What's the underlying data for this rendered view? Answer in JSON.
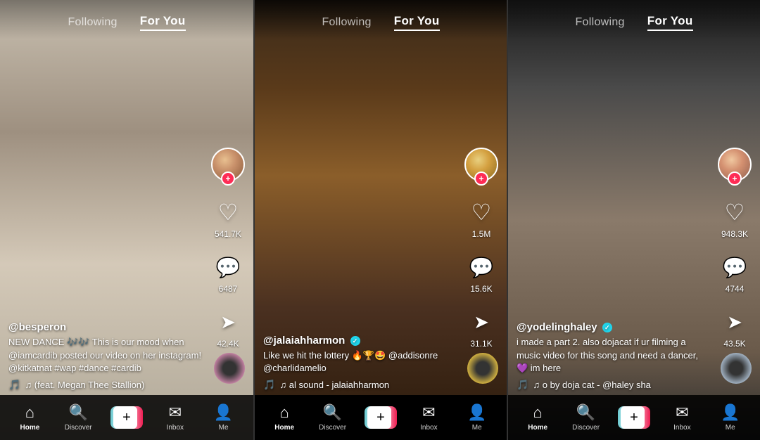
{
  "panels": [
    {
      "id": "panel-1",
      "nav": {
        "following_label": "Following",
        "foryou_label": "For You",
        "active": "foryou"
      },
      "user": {
        "username": "@besperon",
        "verified": false,
        "description": "NEW DANCE 🎶🎶 This is our mood when @iamcardib posted our video on her instagram! @kitkatnat #wap #dance #cardib",
        "music": "♫ (feat. Megan Thee Stallion)"
      },
      "stats": {
        "likes": "541.7K",
        "comments": "6487",
        "shares": "42.4K"
      },
      "bottomnav": {
        "home": "Home",
        "discover": "Discover",
        "inbox": "Inbox",
        "me": "Me"
      }
    },
    {
      "id": "panel-2",
      "nav": {
        "following_label": "Following",
        "foryou_label": "For You",
        "active": "foryou"
      },
      "user": {
        "username": "@jalaiahharmon",
        "verified": true,
        "description": "Like we hit the lottery 🔥🏆🤩 @addisonre @charlidamelio",
        "music": "♫ al sound - jalaiahharmon"
      },
      "stats": {
        "likes": "1.5M",
        "comments": "15.6K",
        "shares": "31.1K"
      },
      "bottomnav": {
        "home": "Home",
        "discover": "Discover",
        "inbox": "Inbox",
        "me": "Me"
      }
    },
    {
      "id": "panel-3",
      "nav": {
        "following_label": "Following",
        "foryou_label": "For You",
        "active": "foryou"
      },
      "user": {
        "username": "@yodelinghaley",
        "verified": true,
        "description": "i made a part 2. also dojacat if ur filming a music video for this song and need a dancer, 💜 im here",
        "music": "♫ o by doja cat - @haley sha"
      },
      "stats": {
        "likes": "948.3K",
        "comments": "4744",
        "shares": "43.5K"
      },
      "bottomnav": {
        "home": "Home",
        "discover": "Discover",
        "inbox": "Inbox",
        "me": "Me"
      }
    }
  ]
}
